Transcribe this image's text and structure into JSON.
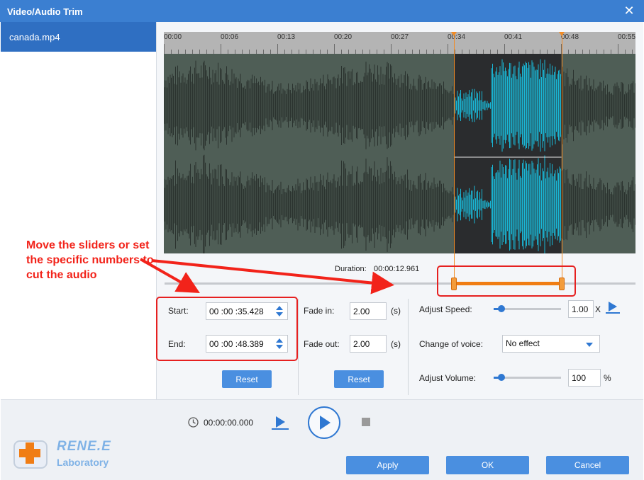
{
  "window": {
    "title": "Video/Audio Trim"
  },
  "sidebar": {
    "items": [
      {
        "label": "canada.mp4"
      }
    ]
  },
  "timeline": {
    "ticks": [
      "00:00",
      "00:06",
      "00:13",
      "00:20",
      "00:27",
      "00:34",
      "00:41",
      "00:48",
      "00:55"
    ],
    "duration_label": "Duration:",
    "duration_value": "00:00:12.961",
    "selection_start_fraction": 0.615,
    "selection_end_fraction": 0.843
  },
  "trim": {
    "start_label": "Start:",
    "start_value": "00 :00 :35.428",
    "end_label": "End:",
    "end_value": "00 :00 :48.389",
    "reset_label": "Reset"
  },
  "fade": {
    "in_label": "Fade in:",
    "in_value": "2.00",
    "out_label": "Fade out:",
    "out_value": "2.00",
    "unit": "(s)",
    "reset_label": "Reset"
  },
  "audio": {
    "speed_label": "Adjust Speed:",
    "speed_value": "1.00",
    "speed_unit": "X",
    "speed_fraction": 0.12,
    "voice_label": "Change of voice:",
    "voice_value": "No effect",
    "volume_label": "Adjust Volume:",
    "volume_value": "100",
    "volume_unit": "%",
    "volume_fraction": 0.12
  },
  "playback": {
    "time": "00:00:00.000"
  },
  "logo": {
    "brand": "RENE.E",
    "sub": "Laboratory"
  },
  "footer": {
    "apply_label": "Apply",
    "ok_label": "OK",
    "cancel_label": "Cancel"
  },
  "annotation": {
    "text": "Move the sliders or set the specific numbers to cut the audio"
  },
  "colors": {
    "accent": "#3b7fd1",
    "button": "#4a8fe0",
    "selection": "#f07d14",
    "wave_selected": "#19b7d6",
    "wave": "#2b332f",
    "annotation": "#f2231a"
  }
}
